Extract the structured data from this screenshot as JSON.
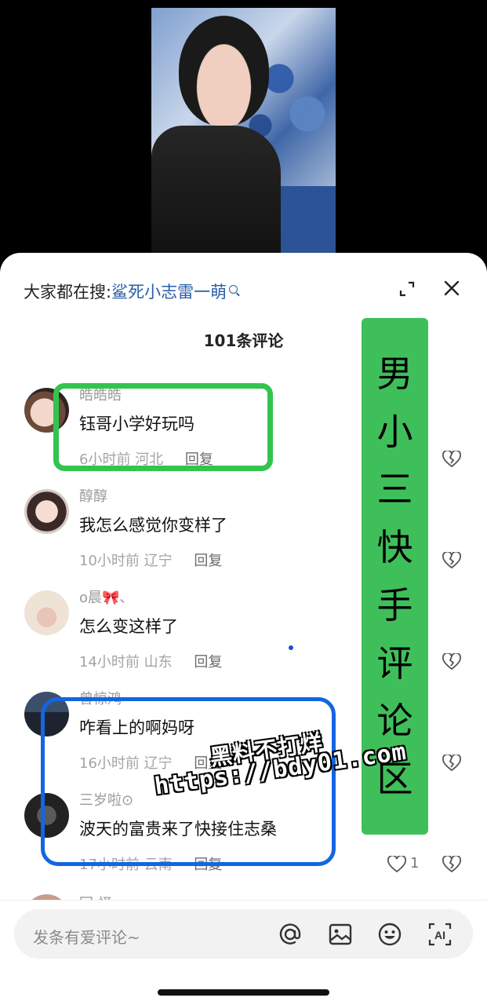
{
  "search": {
    "prefix": "大家都在搜:",
    "term": "鲨死小志雷一萌"
  },
  "comment_count_label": "101条评论",
  "comments": [
    {
      "user": "皓皓皓",
      "text": "钰哥小学好玩吗",
      "time": "6小时前",
      "location": "河北",
      "reply": "回复",
      "likes": ""
    },
    {
      "user": "醇醇",
      "text": "我怎么感觉你变样了",
      "time": "10小时前",
      "location": "辽宁",
      "reply": "回复",
      "likes": ""
    },
    {
      "user": "o晨🎀、",
      "text": "怎么变这样了",
      "time": "14小时前",
      "location": "山东",
      "reply": "回复",
      "likes": ""
    },
    {
      "user": "曾惊鸿",
      "text": "咋看上的啊妈呀",
      "time": "16小时前",
      "location": "辽宁",
      "reply": "回复",
      "likes": ""
    },
    {
      "user": "三岁啦⊙",
      "text": "波天的富贵来了快接住志桑",
      "time": "17小时前",
      "location": "云南",
      "reply": "回复",
      "likes": "1"
    },
    {
      "user": "回 怪",
      "text": "",
      "time": "",
      "location": "",
      "reply": "",
      "likes": ""
    }
  ],
  "input": {
    "placeholder": "发条有爱评论~"
  },
  "overlay": {
    "side_label": [
      "男",
      "小",
      "三",
      "快",
      "手",
      "评",
      "论",
      "区"
    ],
    "watermark_line1": "黑料不打烊",
    "watermark_line2": "https://bdy01.com"
  },
  "colors": {
    "accent_green": "#3fbf5a",
    "box_blue": "#1466e0",
    "search_link": "#2a5ea8"
  },
  "icons": [
    "expand-icon",
    "close-icon",
    "heart-icon",
    "broken-heart-icon",
    "at-icon",
    "image-icon",
    "emoji-icon",
    "ai-icon"
  ]
}
